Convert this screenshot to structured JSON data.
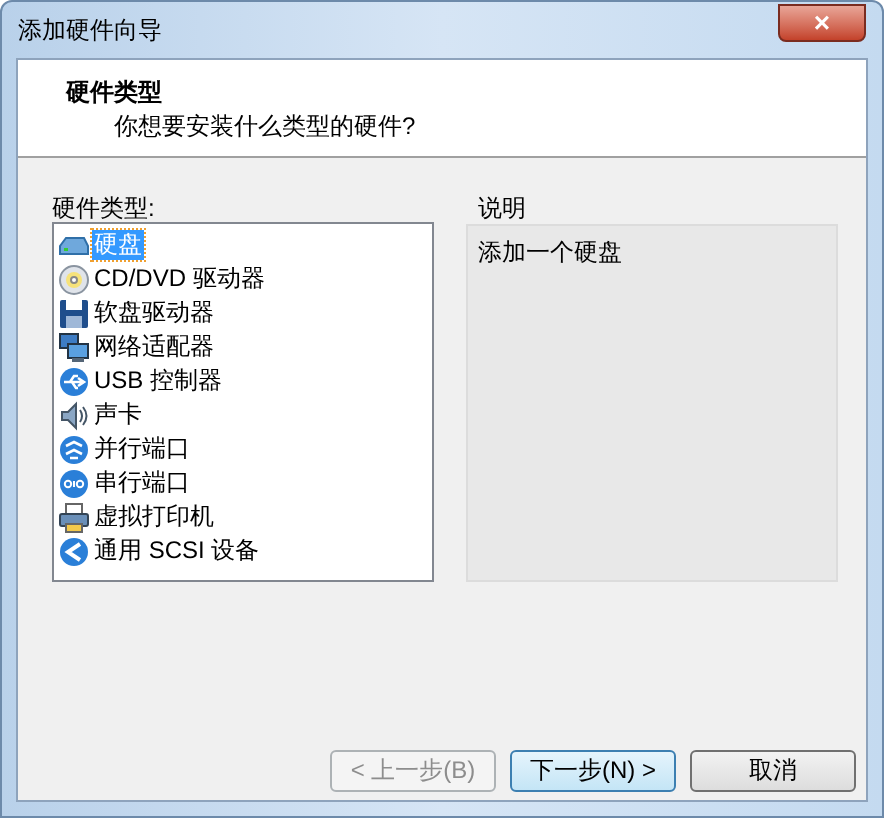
{
  "window": {
    "title": "添加硬件向导",
    "close": "×"
  },
  "header": {
    "title": "硬件类型",
    "subtitle": "你想要安装什么类型的硬件?"
  },
  "hardware_list": {
    "label": "硬件类型:",
    "items": [
      {
        "label": "硬盘",
        "selected": true
      },
      {
        "label": "CD/DVD 驱动器",
        "selected": false
      },
      {
        "label": "软盘驱动器",
        "selected": false
      },
      {
        "label": "网络适配器",
        "selected": false
      },
      {
        "label": "USB 控制器",
        "selected": false
      },
      {
        "label": "声卡",
        "selected": false
      },
      {
        "label": "并行端口",
        "selected": false
      },
      {
        "label": "串行端口",
        "selected": false
      },
      {
        "label": "虚拟打印机",
        "selected": false
      },
      {
        "label": "通用 SCSI 设备",
        "selected": false
      }
    ]
  },
  "description": {
    "label": "说明",
    "text": "添加一个硬盘"
  },
  "buttons": [
    {
      "label": "< 上一步(B)",
      "disabled": true,
      "default": false
    },
    {
      "label": "下一步(N) >",
      "disabled": false,
      "default": true
    },
    {
      "label": "取消",
      "disabled": false,
      "default": false
    }
  ]
}
